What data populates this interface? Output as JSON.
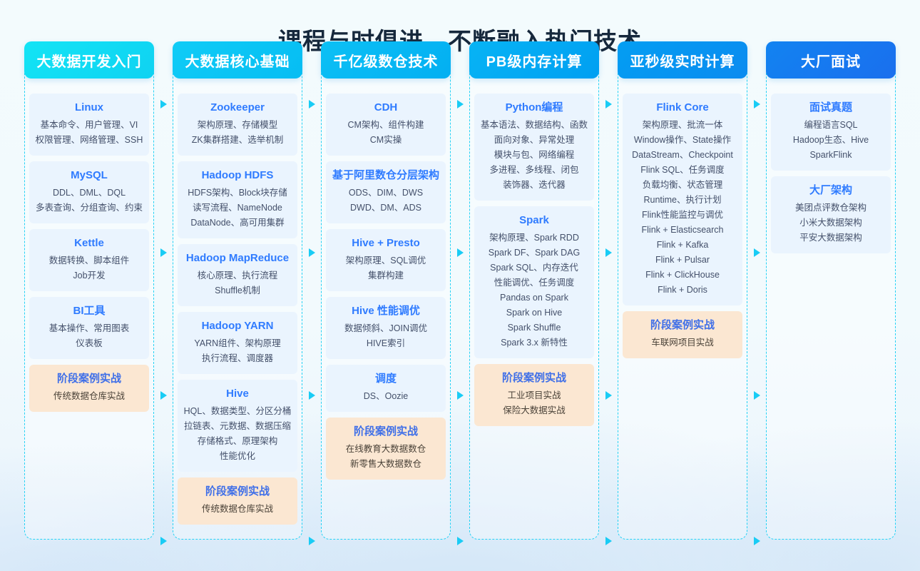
{
  "page": {
    "title": "课程与时俱进，不断融入热门技术",
    "accent_cyan": "#19ccf5",
    "accent_blue": "#1677ff",
    "card_bg": "#eaf4fe",
    "highlight_bg": "#fbe7d2",
    "arrow_icon": "triangle-right-icon"
  },
  "columns": [
    {
      "header": "大数据开发入门",
      "header_color_start": "#13e4f5",
      "header_color_end": "#0fd2f2",
      "cards": [
        {
          "title": "Linux",
          "lines": [
            "基本命令、用户管理、VI",
            "权限管理、网络管理、SSH"
          ],
          "highlight": false
        },
        {
          "title": "MySQL",
          "lines": [
            "DDL、DML、DQL",
            "多表查询、分组查询、约束"
          ],
          "highlight": false
        },
        {
          "title": "Kettle",
          "lines": [
            "数据转换、脚本组件",
            "Job开发"
          ],
          "highlight": false
        },
        {
          "title": "BI工具",
          "lines": [
            "基本操作、常用图表",
            "仪表板"
          ],
          "highlight": false
        },
        {
          "title": "阶段案例实战",
          "lines": [
            "传统数据仓库实战"
          ],
          "highlight": true
        }
      ]
    },
    {
      "header": "大数据核心基础",
      "header_color_start": "#10ccf6",
      "header_color_end": "#06bdf3",
      "cards": [
        {
          "title": "Zookeeper",
          "lines": [
            "架构原理、存储模型",
            "ZK集群搭建、选举机制"
          ],
          "highlight": false
        },
        {
          "title": "Hadoop HDFS",
          "lines": [
            "HDFS架构、Block块存储",
            "读写流程、NameNode",
            "DataNode、高可用集群"
          ],
          "highlight": false
        },
        {
          "title": "Hadoop MapReduce",
          "lines": [
            "核心原理、执行流程",
            "Shuffle机制"
          ],
          "highlight": false
        },
        {
          "title": "Hadoop YARN",
          "lines": [
            "YARN组件、架构原理",
            "执行流程、调度器"
          ],
          "highlight": false
        },
        {
          "title": "Hive",
          "lines": [
            "HQL、数据类型、分区分桶",
            "拉链表、元数据、数据压缩",
            "存储格式、原理架构",
            "性能优化"
          ],
          "highlight": false
        },
        {
          "title": "阶段案例实战",
          "lines": [
            "传统数据仓库实战"
          ],
          "highlight": true
        }
      ]
    },
    {
      "header": "千亿级数仓技术",
      "header_color_start": "#0cc0f5",
      "header_color_end": "#03aff2",
      "cards": [
        {
          "title": "CDH",
          "lines": [
            "CM架构、组件构建",
            "CM实操"
          ],
          "highlight": false
        },
        {
          "title": "基于阿里数仓分层架构",
          "lines": [
            "ODS、DIM、DWS",
            "DWD、DM、ADS"
          ],
          "highlight": false
        },
        {
          "title": "Hive + Presto",
          "lines": [
            "架构原理、SQL调优",
            "集群构建"
          ],
          "highlight": false
        },
        {
          "title": "Hive 性能调优",
          "lines": [
            "数据倾斜、JOIN调优",
            "HIVE索引"
          ],
          "highlight": false
        },
        {
          "title": "调度",
          "lines": [
            "DS、Oozie"
          ],
          "highlight": false
        },
        {
          "title": "阶段案例实战",
          "lines": [
            "在线教育大数据数仓",
            "新零售大数据数仓"
          ],
          "highlight": true
        }
      ]
    },
    {
      "header": "PB级内存计算",
      "header_color_start": "#07b4f4",
      "header_color_end": "#009ff2",
      "cards": [
        {
          "title": "Python编程",
          "lines": [
            "基本语法、数据结构、函数",
            "面向对象、异常处理",
            "模块与包、网络编程",
            "多进程、多线程、闭包",
            "装饰器、迭代器"
          ],
          "highlight": false
        },
        {
          "title": "Spark",
          "lines": [
            "架构原理、Spark RDD",
            "Spark DF、Spark DAG",
            "Spark SQL、内存迭代",
            "性能调优、任务调度",
            "Pandas on Spark",
            "Spark on Hive",
            "Spark Shuffle",
            "Spark 3.x 新特性"
          ],
          "highlight": false
        },
        {
          "title": "阶段案例实战",
          "lines": [
            "工业项目实战",
            "保险大数据实战"
          ],
          "highlight": true
        }
      ]
    },
    {
      "header": "亚秒级实时计算",
      "header_color_start": "#039ef2",
      "header_color_end": "#0b8bf0",
      "cards": [
        {
          "title": "Flink Core",
          "lines": [
            "架构原理、批流一体",
            "Window操作、State操作",
            "DataStream、Checkpoint",
            "Flink SQL、任务调度",
            "负载均衡、状态管理",
            "Runtime、执行计划",
            "Flink性能监控与调优",
            "Flink + Elasticsearch",
            "Flink + Kafka",
            "Flink + Pulsar",
            "Flink + ClickHouse",
            "Flink + Doris"
          ],
          "highlight": false
        },
        {
          "title": "阶段案例实战",
          "lines": [
            "车联网项目实战"
          ],
          "highlight": true
        }
      ]
    },
    {
      "header": "大厂面试",
      "header_color_start": "#1283f1",
      "header_color_end": "#1a6fee",
      "cards": [
        {
          "title": "面试真题",
          "lines": [
            "编程语言SQL",
            "Hadoop生态、Hive",
            "SparkFlink"
          ],
          "highlight": false
        },
        {
          "title": "大厂架构",
          "lines": [
            "美团点评数仓架构",
            "小米大数据架构",
            "平安大数据架构"
          ],
          "highlight": false
        }
      ]
    }
  ],
  "arrows": {
    "gap_tops": [
      140,
      348,
      548,
      752
    ]
  }
}
